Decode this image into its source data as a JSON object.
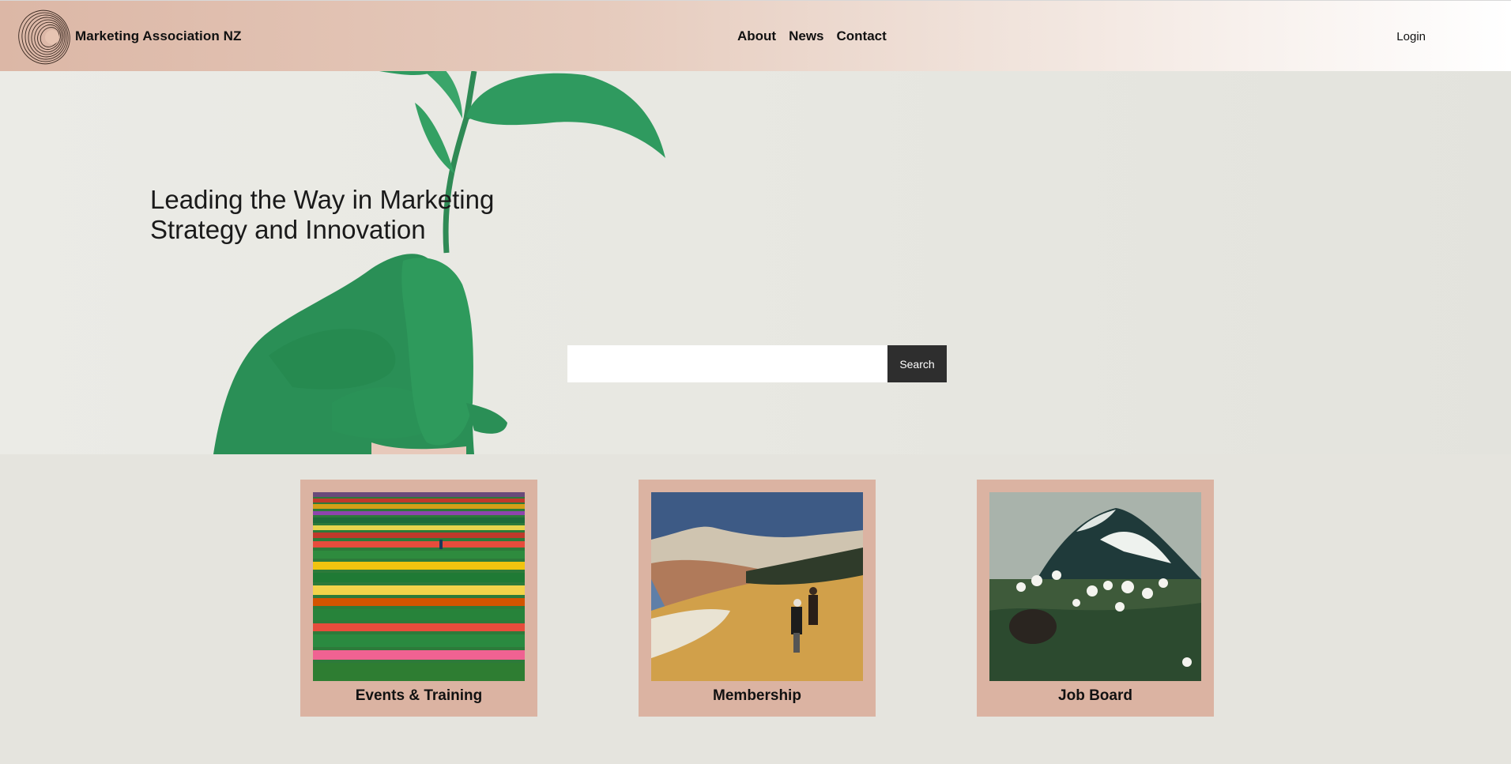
{
  "header": {
    "brand": "Marketing Association NZ",
    "logo_icon": "spiral-logo-icon",
    "nav": [
      {
        "label": "About"
      },
      {
        "label": "News"
      },
      {
        "label": "Contact"
      }
    ],
    "login_label": "Login"
  },
  "hero": {
    "headline_line1": "Leading the Way in Marketing",
    "headline_line2": "Strategy and Innovation",
    "search": {
      "value": "",
      "placeholder": "",
      "button_label": "Search"
    },
    "image": "green-painted-hand-holding-plant"
  },
  "cards": [
    {
      "label": "Events & Training",
      "image": "tulip-fields-photo"
    },
    {
      "label": "Membership",
      "image": "coastal-cliffs-hikers-photo"
    },
    {
      "label": "Job Board",
      "image": "mountain-wildflowers-photo"
    }
  ],
  "colors": {
    "header_gradient_start": "#dcb7a6",
    "card_background": "#dbb3a2",
    "page_background": "#e5e4de",
    "search_button": "#2e2e2e"
  }
}
